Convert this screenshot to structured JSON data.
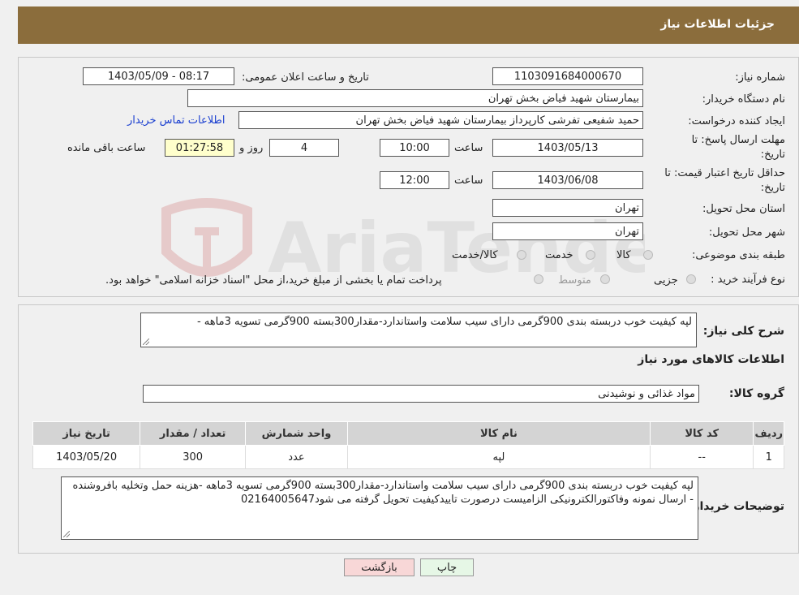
{
  "header": {
    "title": "جزئیات اطلاعات نیاز"
  },
  "form": {
    "need_number_label": "شماره نیاز:",
    "need_number": "1103091684000670",
    "announce_label": "تاریخ و ساعت اعلان عمومی:",
    "announce_value": "1403/05/09 - 08:17",
    "buyer_org_label": "نام دستگاه خریدار:",
    "buyer_org": "بیمارستان شهید فیاض بخش تهران",
    "creator_label": "ایجاد کننده درخواست:",
    "creator": "حمید شفیعی تفرشی کارپرداز بیمارستان شهید فیاض بخش تهران",
    "contact_link": "اطلاعات تماس خریدار",
    "deadline_label_1": "مهلت ارسال پاسخ: تا",
    "deadline_label_2": "تاریخ:",
    "deadline_date": "1403/05/13",
    "time_label": "ساعت",
    "deadline_time": "10:00",
    "days_value": "4",
    "days_label": "روز و",
    "remaining_time": "01:27:58",
    "remaining_label": "ساعت باقی مانده",
    "validity_label_1": "حداقل تاریخ اعتبار قیمت: تا",
    "validity_label_2": "تاریخ:",
    "validity_date": "1403/06/08",
    "validity_time": "12:00",
    "province_label": "استان محل تحویل:",
    "province": "تهران",
    "city_label": "شهر محل تحویل:",
    "city": "تهران",
    "category_label": "طبقه بندی موضوعی:",
    "category_options": [
      "کالا",
      "خدمت",
      "کالا/خدمت"
    ],
    "process_label": "نوع فرآیند خرید :",
    "process_options": [
      "جزیی",
      "متوسط"
    ],
    "process_note": "پرداخت تمام یا بخشی از مبلغ خرید،از محل \"اسناد خزانه اسلامی\" خواهد بود."
  },
  "summary": {
    "label": "شرح کلی نیاز:",
    "text": "لپه  کیفیت خوب دربسته بندی 900گرمی دارای سیب سلامت واستاندارد-مقدار300بسته 900گرمی تسویه 3ماهه -",
    "goods_info_title": "اطلاعات کالاهای مورد نیاز",
    "group_label": "گروه کالا:",
    "group_value": "مواد غذائی و نوشیدنی"
  },
  "table": {
    "headers": [
      "ردیف",
      "کد کالا",
      "نام کالا",
      "واحد شمارش",
      "تعداد / مقدار",
      "تاریخ نیاز"
    ],
    "rows": [
      [
        "1",
        "--",
        "لپه",
        "عدد",
        "300",
        "1403/05/20"
      ]
    ]
  },
  "buyer_notes": {
    "label": "توضیحات خریدار:",
    "text": "لپه کیفیت خوب دربسته بندی 900گرمی دارای سیب سلامت واستاندارد-مقدار300بسته 900گرمی تسویه 3ماهه -هزینه حمل وتخلیه بافروشنده -  ارسال نمونه وفاکتورالکترونیکی الزامیست درصورت تاییدکیفیت تحویل گرفته می شود02164005647"
  },
  "buttons": {
    "print": "چاپ",
    "back": "بازگشت"
  },
  "watermark_text": "AriaTender.neT",
  "colors": {
    "header_bg": "#8b6d3c",
    "back_btn_bg": "#f8d7d7",
    "print_btn_bg": "#e6f7e6"
  }
}
